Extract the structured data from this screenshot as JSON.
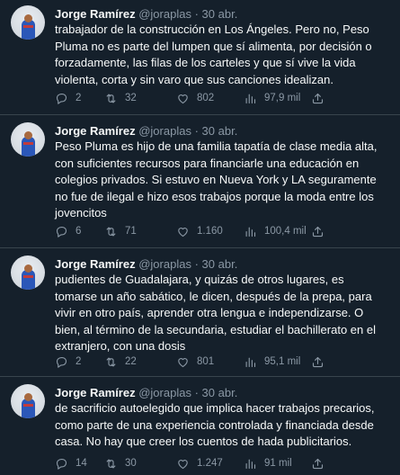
{
  "colors": {
    "background": "#15202b",
    "text_primary": "#f7f9f9",
    "text_secondary": "#8b98a5",
    "separator": "#38444d"
  },
  "icons": {
    "reply": "reply-icon",
    "retweet": "retweet-icon",
    "like": "heart-icon",
    "views": "views-chart-icon",
    "share": "share-icon"
  },
  "tweets": [
    {
      "author_name": "Jorge Ramírez",
      "handle": "@joraplas",
      "separator": "·",
      "date": "30 abr.",
      "lines": [
        "trabajador de la construcción en Los Ángeles. Pero no, Peso",
        "Pluma no es parte del lumpen que sí alimenta, por decisión o",
        "forzadamente, las filas de los carteles y que sí vive la vida",
        "violenta, corta y sin varo que sus canciones idealizan."
      ],
      "replies": "2",
      "retweets": "32",
      "likes": "802",
      "views": "97,9 mil"
    },
    {
      "author_name": "Jorge Ramírez",
      "handle": "@joraplas",
      "separator": "·",
      "date": "30 abr.",
      "lines": [
        "Peso Pluma es hijo de una familia tapatía de clase media alta,",
        "con suficientes recursos para financiarle una educación en",
        "colegios privados. Si estuvo en Nueva York y LA seguramente",
        "no fue de ilegal e hizo esos trabajos porque la moda entre los",
        "jovencitos"
      ],
      "replies": "6",
      "retweets": "71",
      "likes": "1.160",
      "views": "100,4 mil"
    },
    {
      "author_name": "Jorge Ramírez",
      "handle": "@joraplas",
      "separator": "·",
      "date": "30 abr.",
      "lines": [
        "pudientes de Guadalajara, y quizás de otros lugares, es",
        "tomarse un año sabático, le dicen, después de la prepa, para",
        "vivir en otro país, aprender otra lengua e independizarse. O",
        "bien, al término de la secundaria, estudiar el bachillerato en el",
        "extranjero, con una dosis"
      ],
      "replies": "2",
      "retweets": "22",
      "likes": "801",
      "views": "95,1 mil"
    },
    {
      "author_name": "Jorge Ramírez",
      "handle": "@joraplas",
      "separator": "·",
      "date": "30 abr.",
      "lines": [
        "de sacrificio autoelegido que implica hacer trabajos precarios,",
        "como parte de una experiencia controlada y financiada desde",
        "casa. No hay que creer los cuentos de hada publicitarios."
      ],
      "replies": "14",
      "retweets": "30",
      "likes": "1.247",
      "views": "91 mil"
    }
  ]
}
